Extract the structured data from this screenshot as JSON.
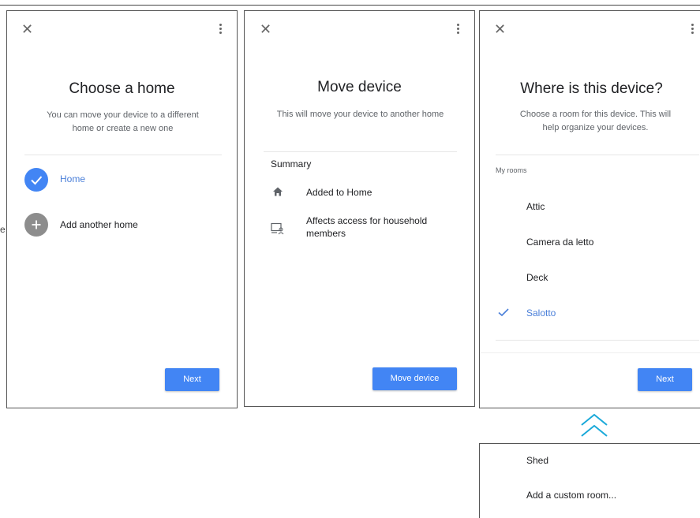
{
  "side_fragment": "e",
  "panel1": {
    "title": "Choose a home",
    "subtitle_line1": "You can move your device to a different",
    "subtitle_line2": "home or create a new one",
    "options": [
      {
        "label": "Home",
        "selected": true
      },
      {
        "label": "Add another home",
        "selected": false
      }
    ],
    "next_label": "Next"
  },
  "panel2": {
    "title": "Move device",
    "subtitle": "This will move your device to another home",
    "summary_label": "Summary",
    "items": [
      {
        "icon": "home-icon",
        "line1": "Added to Home",
        "line2": ""
      },
      {
        "icon": "household-access-icon",
        "line1": "Affects access for household",
        "line2": "members"
      }
    ],
    "button_label": "Move device"
  },
  "panel3": {
    "title": "Where is this device?",
    "subtitle_line1": "Choose a room for this device. This will",
    "subtitle_line2": "help organize your devices.",
    "section_label": "My rooms",
    "rooms": [
      {
        "label": "Attic",
        "selected": false
      },
      {
        "label": "Camera da letto",
        "selected": false
      },
      {
        "label": "Deck",
        "selected": false
      },
      {
        "label": "Salotto",
        "selected": true
      }
    ],
    "next_label": "Next"
  },
  "extra_rooms": [
    "Shed",
    "Add a custom room..."
  ],
  "colors": {
    "accent": "#4285f4",
    "selected_text": "#4a7fd9",
    "grey_icon": "#8d8d8d"
  }
}
